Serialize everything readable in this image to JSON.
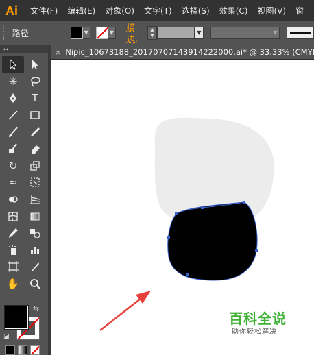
{
  "app": {
    "logo": "Ai"
  },
  "menu": [
    "文件(F)",
    "编辑(E)",
    "对象(O)",
    "文字(T)",
    "选择(S)",
    "效果(C)",
    "视图(V)",
    "窗"
  ],
  "control_bar": {
    "selection_label": "路径",
    "stroke_label": "描边:",
    "fill_color": "#000000",
    "stroke_color": "none"
  },
  "document": {
    "tab_title": "Nipic_10673188_20170707143914222000.ai* @ 33.33% (CMYK/",
    "close_glyph": "×"
  },
  "tools": [
    "selection-tool",
    "direct-selection-tool",
    "magic-wand-tool",
    "lasso-tool",
    "pen-tool",
    "type-tool",
    "line-segment-tool",
    "rectangle-tool",
    "paintbrush-tool",
    "pencil-tool",
    "blob-brush-tool",
    "eraser-tool",
    "rotate-tool",
    "scale-tool",
    "width-tool",
    "free-transform-tool",
    "shape-builder-tool",
    "perspective-grid-tool",
    "mesh-tool",
    "gradient-tool",
    "eyedropper-tool",
    "blend-tool",
    "symbol-sprayer-tool",
    "column-graph-tool",
    "artboard-tool",
    "slice-tool",
    "hand-tool",
    "zoom-tool"
  ],
  "colors": {
    "accent": "#ff9a00",
    "arrow": "#e8403a",
    "path": "#3a5fc8",
    "head": "#ececec"
  },
  "watermark": {
    "title": "百科全说",
    "subtitle": "助你轻松解决"
  }
}
